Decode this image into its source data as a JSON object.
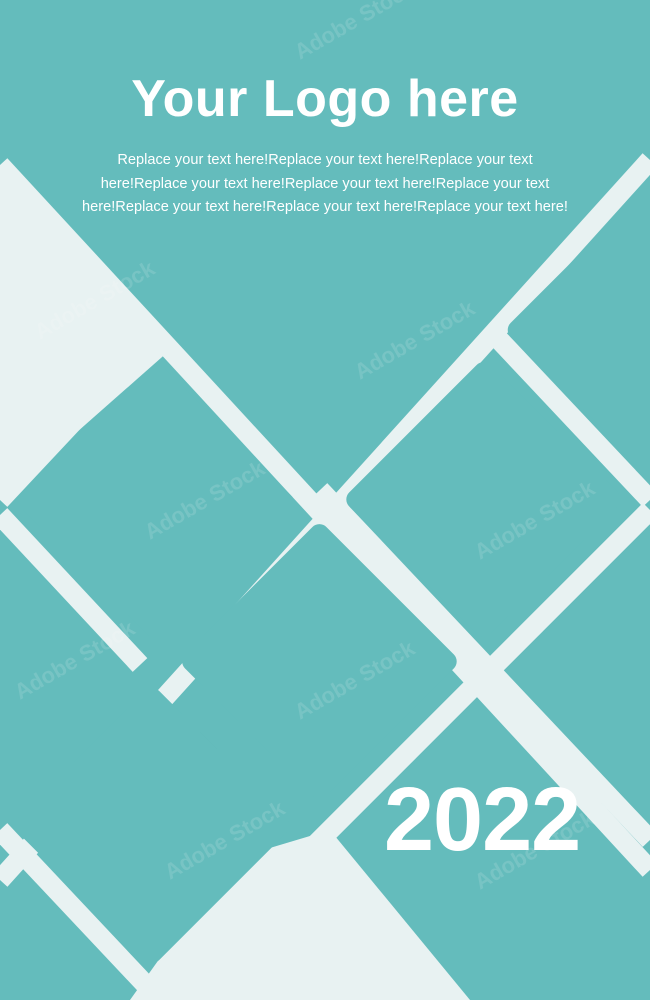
{
  "poster": {
    "logo_text": "Your Logo here",
    "body_text": "Replace your text here!Replace your text here!Replace your text here!Replace your text here!Replace your text here!Replace your text here!Replace your text here!Replace your text here!Replace your text here!",
    "year": "2022",
    "watermark": "Adobe Stock"
  },
  "colors": {
    "background": "#64bcbc",
    "light_band": "#e8f2f2",
    "text": "#ffffff"
  }
}
